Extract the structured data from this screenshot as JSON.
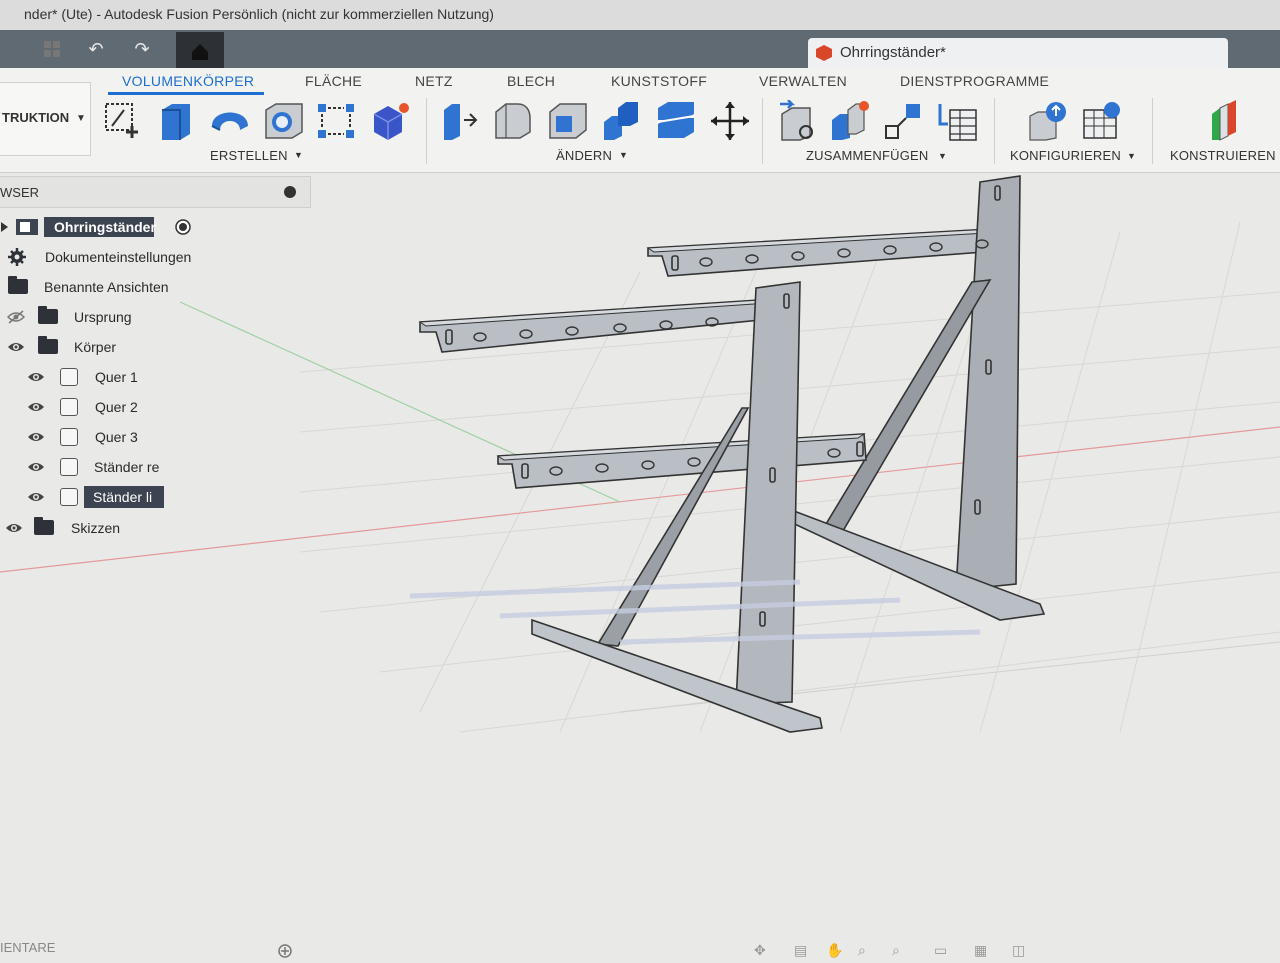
{
  "window": {
    "title": "nder* (Ute) - Autodesk Fusion Persönlich (nicht zur kommerziellen Nutzung)"
  },
  "document": {
    "tab_title": "Ohrringständer*"
  },
  "quick_access": {
    "icons": [
      "grid-icon",
      "undo-icon",
      "redo-icon",
      "home-icon"
    ]
  },
  "ribbon": {
    "workspace": "TRUKTION",
    "tabs": [
      {
        "label": "VOLUMENKÖRPER",
        "active": true
      },
      {
        "label": "FLÄCHE"
      },
      {
        "label": "NETZ"
      },
      {
        "label": "BLECH"
      },
      {
        "label": "KUNSTSTOFF"
      },
      {
        "label": "VERWALTEN"
      },
      {
        "label": "DIENSTPROGRAMME"
      }
    ],
    "groups": {
      "erstellen": "ERSTELLEN",
      "aendern": "ÄNDERN",
      "zusammenfuegen": "ZUSAMMENFÜGEN",
      "konfigurieren": "KONFIGURIEREN",
      "konstruieren": "KONSTRUIEREN"
    }
  },
  "browser": {
    "title": "WSER",
    "root": "Ohrringständer",
    "items": [
      {
        "label": "Dokumenteinstellungen",
        "icon": "gear-icon"
      },
      {
        "label": "Benannte Ansichten",
        "icon": "folder-icon"
      },
      {
        "label": "Ursprung",
        "icon": "folder-icon",
        "visible": false
      },
      {
        "label": "Körper",
        "icon": "folder-icon",
        "visible": true
      },
      {
        "label": "Quer 1",
        "icon": "body-icon",
        "visible": true
      },
      {
        "label": "Quer 2",
        "icon": "body-icon",
        "visible": true
      },
      {
        "label": "Quer 3",
        "icon": "body-icon",
        "visible": true
      },
      {
        "label": "Ständer re",
        "icon": "body-icon",
        "visible": true
      },
      {
        "label": "Ständer li",
        "icon": "body-icon",
        "visible": true,
        "selected": true
      },
      {
        "label": "Skizzen",
        "icon": "folder-icon",
        "visible": true
      }
    ]
  },
  "bottom": {
    "comments": "IENTARE"
  },
  "colors": {
    "accent": "#1c6fd1",
    "toolbar_dark": "#5f6a73",
    "selection": "#3b4450",
    "model": "#b8bec4"
  }
}
